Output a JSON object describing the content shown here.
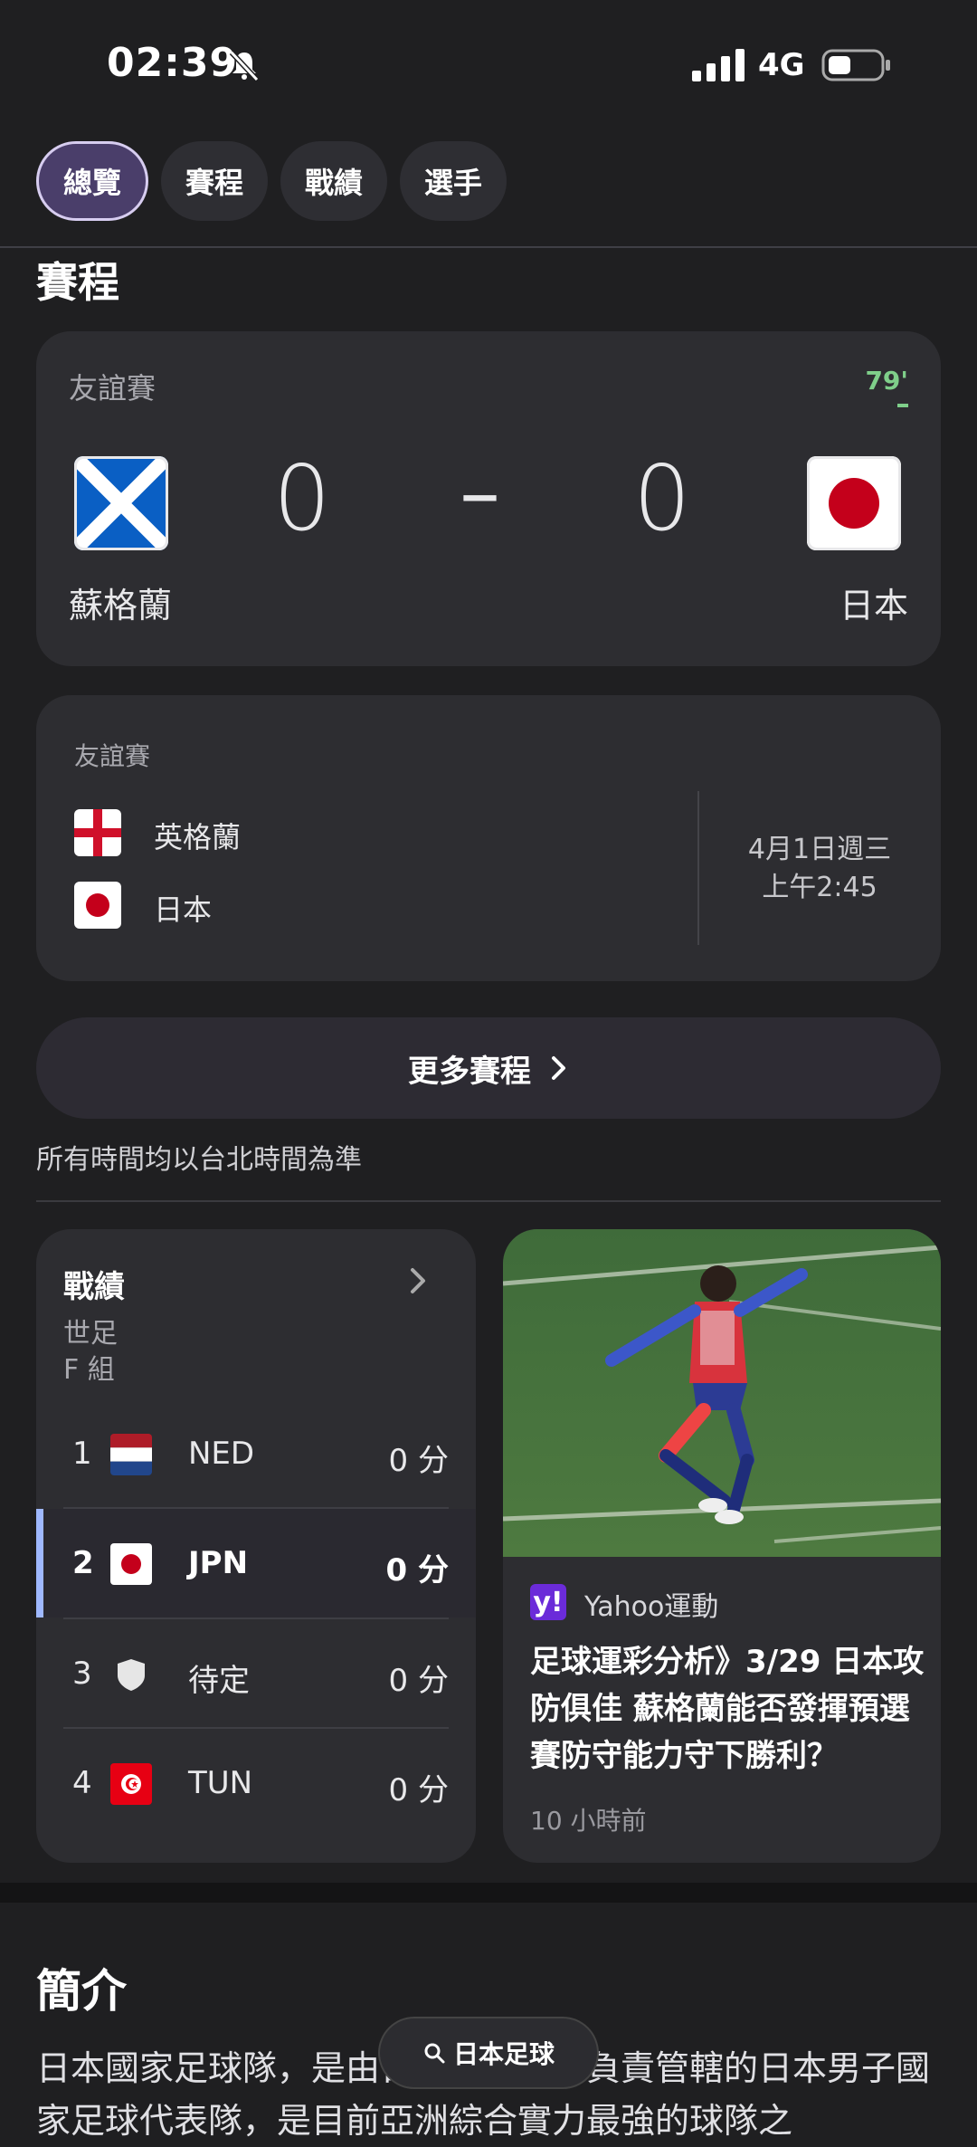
{
  "status_bar": {
    "time": "02:39",
    "network": "4G"
  },
  "tabs": [
    {
      "label": "總覽",
      "active": true
    },
    {
      "label": "賽程",
      "active": false
    },
    {
      "label": "戰績",
      "active": false
    },
    {
      "label": "選手",
      "active": false
    }
  ],
  "schedule": {
    "title": "賽程",
    "live_match": {
      "competition": "友誼賽",
      "minute": "79'",
      "home_team": "蘇格蘭",
      "away_team": "日本",
      "home_score": "0",
      "away_score": "0",
      "separator": "–"
    },
    "upcoming_match": {
      "competition": "友誼賽",
      "home_team": "英格蘭",
      "away_team": "日本",
      "date": "4月1日週三",
      "time": "上午2:45"
    },
    "more_button": "更多賽程",
    "timezone_note": "所有時間均以台北時間為準"
  },
  "standings": {
    "title": "戰績",
    "subtitle1": "世足",
    "subtitle2": "F 組",
    "rows": [
      {
        "rank": "1",
        "code": "NED",
        "points": "0 分"
      },
      {
        "rank": "2",
        "code": "JPN",
        "points": "0 分"
      },
      {
        "rank": "3",
        "code": "待定",
        "points": "0 分"
      },
      {
        "rank": "4",
        "code": "TUN",
        "points": "0 分"
      }
    ]
  },
  "news": {
    "source": "Yahoo運動",
    "logo_letter": "y!",
    "headline": "足球運彩分析》3/29 日本攻防俱佳 蘇格蘭能否發揮預選賽防守能力守下勝利？",
    "time_ago": "10 小時前"
  },
  "intro": {
    "title": "簡介",
    "text": "日本國家足球隊，是由日本足球協會負責管轄的日本男子國家足球代表隊，是目前亞洲綜合實力最強的球隊之"
  },
  "search_pill": {
    "label": "日本足球"
  },
  "colors": {
    "accent_tab": "#4a3e6a",
    "live_minute": "#7fcf8a",
    "highlight_bar": "#9fb8ff",
    "yahoo": "#6b2bd9"
  }
}
